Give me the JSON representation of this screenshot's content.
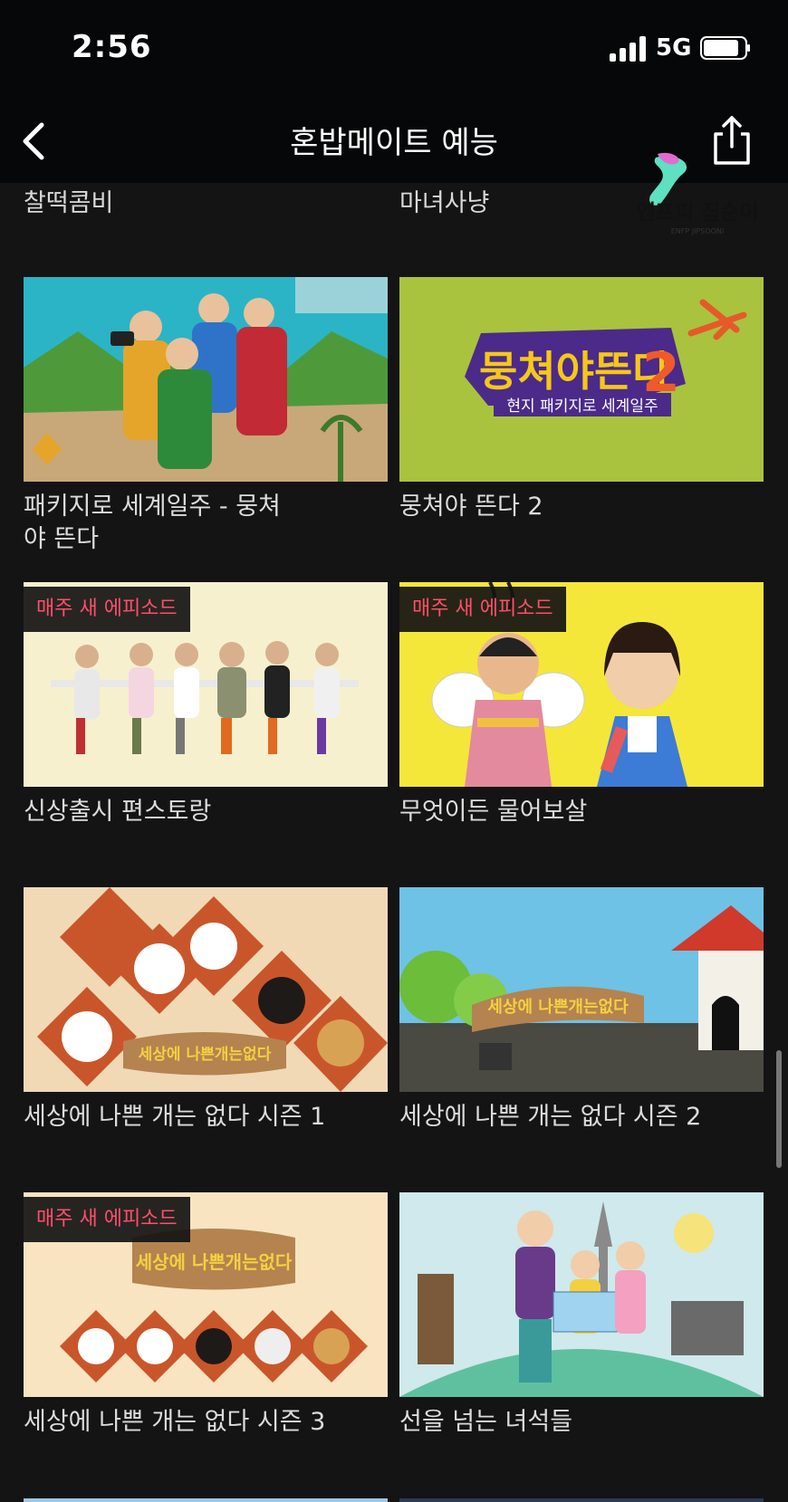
{
  "status_bar": {
    "time": "2:56",
    "network": "5G"
  },
  "header": {
    "title": "혼밥메이트 예능"
  },
  "watermark": {
    "text": "엔프피 집순이",
    "sub": "ENFP JIPSOONI"
  },
  "previous_row": [
    "찰떡콤비",
    "마녀사냥"
  ],
  "shows": [
    {
      "title": "패키지로 세계일주 - 뭉쳐야 뜬다",
      "badge": ""
    },
    {
      "title": "뭉쳐야 뜬다 2",
      "badge": "",
      "logo_main": "뭉쳐야뜬다",
      "logo_num": "2",
      "logo_sub": "현지 패키지로 세계일주"
    },
    {
      "title": "신상출시 편스토랑",
      "badge": "매주 새 에피소드"
    },
    {
      "title": "무엇이든 물어보살",
      "badge": "매주 새 에피소드"
    },
    {
      "title": "세상에 나쁜 개는 없다 시즌 1",
      "badge": "",
      "logo": "세상에 나쁜개는없다"
    },
    {
      "title": "세상에 나쁜 개는 없다 시즌 2",
      "badge": "",
      "logo": "세상에 나쁜개는없다"
    },
    {
      "title": "세상에 나쁜 개는 없다 시즌 3",
      "badge": "매주 새 에피소드",
      "logo": "세상에 나쁜개는없다"
    },
    {
      "title": "선을 넘는 녀석들",
      "badge": ""
    }
  ],
  "colors": {
    "background": "#141414",
    "badge_text": "#ff4e6a",
    "header_bg": "#060708"
  },
  "icons": [
    "back-chevron-icon",
    "share-icon",
    "signal-icon",
    "battery-icon"
  ]
}
